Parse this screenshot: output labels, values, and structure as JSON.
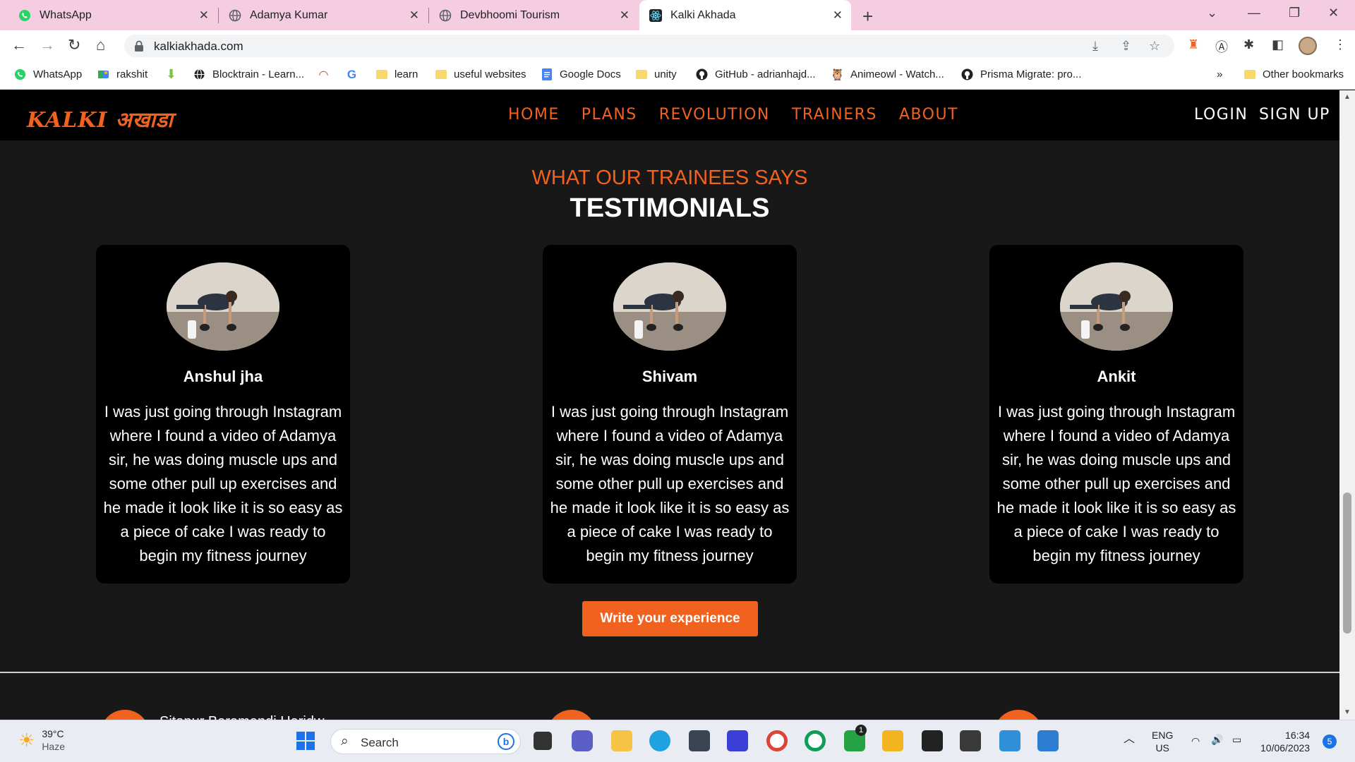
{
  "browser": {
    "tabs": [
      {
        "title": "WhatsApp",
        "icon": "whatsapp-icon"
      },
      {
        "title": "Adamya Kumar",
        "icon": "globe-icon"
      },
      {
        "title": "Devbhoomi Tourism",
        "icon": "globe-icon"
      },
      {
        "title": "Kalki Akhada",
        "icon": "react-icon",
        "active": true
      }
    ],
    "url": "kalkiakhada.com",
    "bookmarks": [
      {
        "label": "WhatsApp"
      },
      {
        "label": "rakshit"
      },
      {
        "label": ""
      },
      {
        "label": "Blocktrain - Learn..."
      },
      {
        "label": ""
      },
      {
        "label": ""
      },
      {
        "label": "learn"
      },
      {
        "label": "useful websites"
      },
      {
        "label": "Google Docs"
      },
      {
        "label": "unity"
      },
      {
        "label": "GitHub - adrianhajd..."
      },
      {
        "label": "Animeowl - Watch..."
      },
      {
        "label": "Prisma Migrate: pro..."
      }
    ],
    "bookmarks_overflow": "»",
    "other_bookmarks": "Other bookmarks"
  },
  "site": {
    "logo": "KALKI अखाडा",
    "nav": [
      "HOME",
      "PLANS",
      "REVOLUTION",
      "TRAINERS",
      "ABOUT"
    ],
    "login": "LOGIN",
    "signup": "SIGN UP",
    "eyebrow": "WHAT OUR TRAINEES SAYS",
    "heading": "TESTIMONIALS",
    "testimonials": [
      {
        "name": "Anshul jha",
        "text": "I was just going through Instagram where I found a video of Adamya sir, he was doing muscle ups and some other pull up exercises and he made it look like it is so easy as a piece of cake I was ready to begin my fitness journey"
      },
      {
        "name": "Shivam",
        "text": "I was just going through Instagram where I found a video of Adamya sir, he was doing muscle ups and some other pull up exercises and he made it look like it is so easy as a piece of cake I was ready to begin my fitness journey"
      },
      {
        "name": "Ankit",
        "text": "I was just going through Instagram where I found a video of Adamya sir, he was doing muscle ups and some other pull up exercises and he made it look like it is so easy as a piece of cake I was ready to begin my fitness journey"
      }
    ],
    "cta": "Write your experience",
    "footer_partial": "Sitapur Baramandi Haridw"
  },
  "taskbar": {
    "temperature": "39°C",
    "weather": "Haze",
    "search_placeholder": "Search",
    "language": "ENG",
    "region": "US",
    "time": "16:34",
    "date": "10/06/2023",
    "notification_count": "5",
    "whatsapp_badge": "1"
  },
  "colors": {
    "accent": "#f2621f",
    "tabbar": "#f4cde1",
    "page_bg": "#181818",
    "card_bg": "#000000"
  }
}
